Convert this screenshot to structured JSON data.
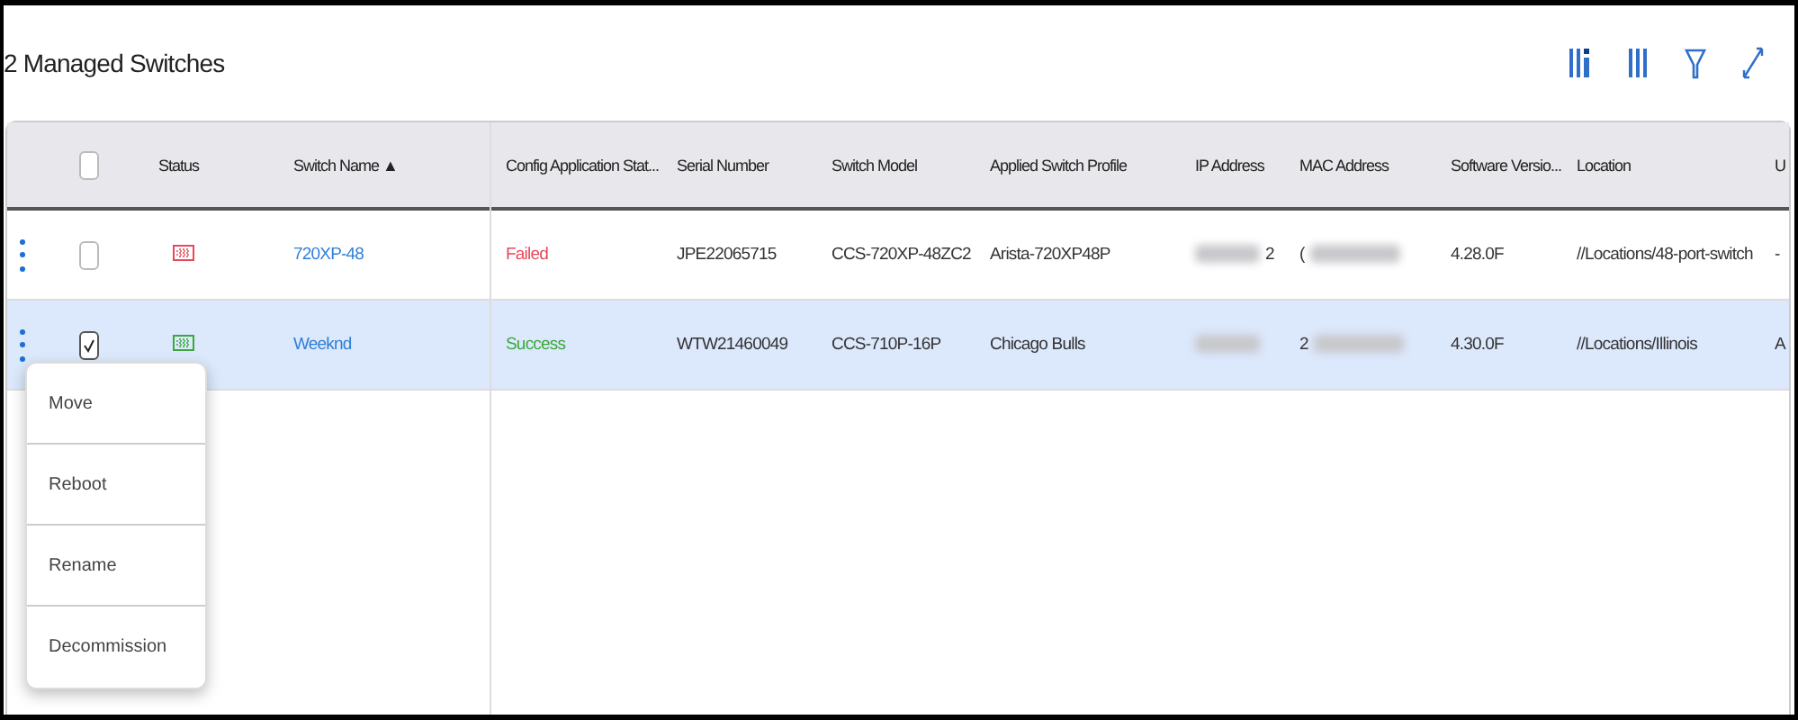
{
  "title": "2 Managed Switches",
  "toolbar": [
    {
      "kind": "columns-info"
    },
    {
      "kind": "columns"
    },
    {
      "kind": "filter"
    },
    {
      "kind": "expand"
    }
  ],
  "header_checkbox": {
    "checked": false
  },
  "columns": [
    {
      "label": "Status"
    },
    {
      "label": "Switch Name",
      "sort": "▲"
    },
    {
      "label": "Config Application Stat..."
    },
    {
      "label": "Serial Number"
    },
    {
      "label": "Switch Model"
    },
    {
      "label": "Applied Switch Profile"
    },
    {
      "label": "IP Address"
    },
    {
      "label": "MAC Address"
    },
    {
      "label": "Software Versio..."
    },
    {
      "label": "Location"
    },
    {
      "label": "U"
    }
  ],
  "rows": [
    {
      "checked": false,
      "selected": false,
      "color": "#e8485a",
      "name": "720XP-48",
      "config": "Failed",
      "serial": "JPE22065715",
      "model": "CCS-720XP-48ZC2",
      "profile": "Arista-720XP48P",
      "ip_visible": "2",
      "mac_visible": "(",
      "software": "4.28.0F",
      "location": "//Locations/48-port-switch",
      "column_11": "-"
    },
    {
      "checked": true,
      "selected": true,
      "color": "#3aa93a",
      "name": "Weeknd",
      "config": "Success",
      "serial": "WTW21460049",
      "model": "CCS-710P-16P",
      "profile": "Chicago Bulls",
      "ip_visible": "",
      "mac_visible": "2",
      "software": "4.30.0F",
      "location": "//Locations/Illinois",
      "column_11": "A"
    }
  ],
  "menu": [
    "Move",
    "Reboot",
    "Rename",
    "Decommission"
  ]
}
